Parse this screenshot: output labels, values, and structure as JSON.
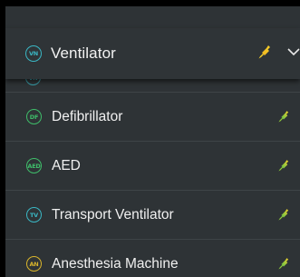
{
  "selected": {
    "badge": "VN",
    "label": "Ventilator",
    "icon": "plug-icon",
    "chevron_icon": "chevron-down-icon"
  },
  "partial_item": {
    "label": "Ventilator"
  },
  "items": [
    {
      "badge": "DF",
      "label": "Defibrillator",
      "badge_color": "#3fbd6a",
      "icon": "plug-icon"
    },
    {
      "badge": "AED",
      "label": "AED",
      "badge_color": "#3fbd6a",
      "icon": "plug-icon"
    },
    {
      "badge": "TV",
      "label": "Transport Ventilator",
      "badge_color": "#3ab7c4",
      "icon": "plug-icon"
    },
    {
      "badge": "AN",
      "label": "Anesthesia Machine",
      "badge_color": "#d9b52c",
      "icon": "plug-icon"
    }
  ],
  "colors": {
    "background": "#2e3336",
    "plug_gradient_start": "#f7d02a",
    "plug_gradient_end": "#5bc24a",
    "teal": "#3ab7c4",
    "green": "#3fbd6a",
    "yellow": "#d9b52c"
  }
}
